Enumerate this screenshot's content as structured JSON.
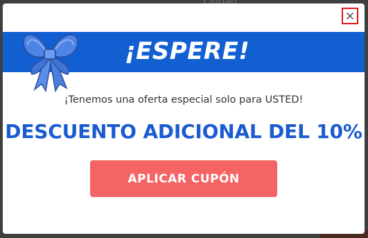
{
  "background": {
    "partial_text": "Ciudad"
  },
  "modal": {
    "close_icon": "close-icon",
    "bow_icon": "gift-bow-icon",
    "banner_title": "¡ESPERE!",
    "subtitle": "¡Tenemos una oferta especial solo para USTED!",
    "discount_text": "DESCUENTO ADICIONAL DEL 10%",
    "apply_button_label": "APLICAR CUPÓN"
  },
  "colors": {
    "banner": "#125fd2",
    "discount_text": "#1b5bd0",
    "button": "#f46464",
    "close_outline": "#e01414"
  }
}
